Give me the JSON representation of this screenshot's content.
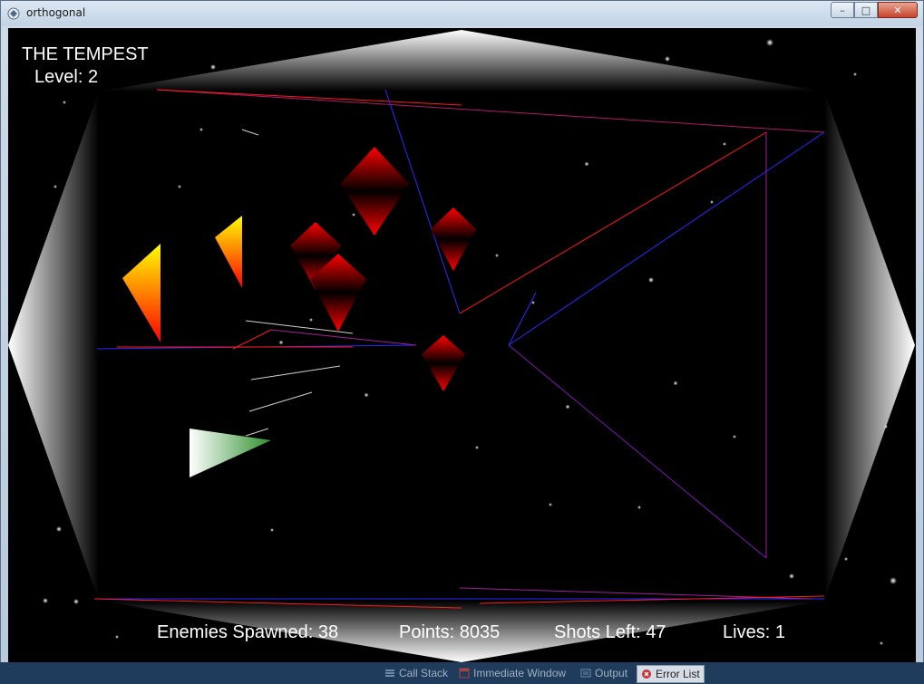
{
  "window": {
    "title": "orthogonal",
    "icon": "app-icon",
    "controls": {
      "minimize": "–",
      "maximize": "□",
      "close": "✕"
    }
  },
  "hud": {
    "game_title": "THE TEMPEST",
    "level_label": "Level:",
    "level_value": "2"
  },
  "status": {
    "enemies_label": "Enemies Spawned:",
    "enemies_value": "38",
    "points_label": "Points:",
    "points_value": "8035",
    "shots_label": "Shots Left:",
    "shots_value": "47",
    "lives_label": "Lives:",
    "lives_value": "1"
  },
  "taskbar": {
    "items": [
      {
        "label": "Call Stack",
        "icon": "call-stack-icon"
      },
      {
        "label": "Immediate Window",
        "icon": "immediate-window-icon"
      },
      {
        "label": "Output",
        "icon": "output-icon"
      },
      {
        "label": "Error List",
        "icon": "error-list-icon"
      }
    ]
  },
  "colors": {
    "background": "#000000",
    "line_red": "#ff1a1a",
    "line_blue": "#2a2aff",
    "enemy_red": "#e00000",
    "flipper_yellow": "#ffe000",
    "player_green": "#2f8f2f",
    "hud_text": "#ffffff"
  }
}
